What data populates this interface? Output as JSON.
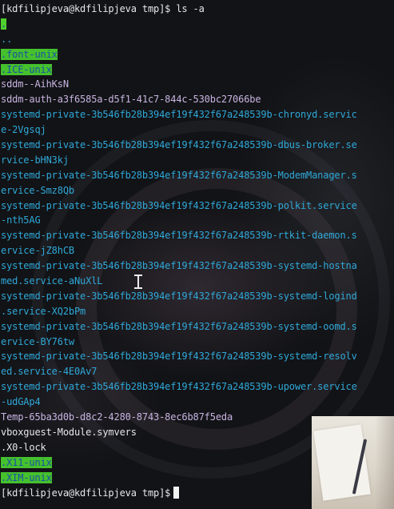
{
  "terminal": {
    "lines": [
      {
        "segments": [
          {
            "text": "[kdfilipjeva@kdfilipjeva tmp]$ ls -a",
            "style": "prompt"
          }
        ]
      },
      {
        "segments": [
          {
            "text": ".",
            "style": "hl-dot"
          }
        ]
      },
      {
        "segments": [
          {
            "text": "..",
            "style": "cyan"
          }
        ]
      },
      {
        "segments": [
          {
            "text": ".font-unix",
            "style": "hl"
          }
        ]
      },
      {
        "segments": [
          {
            "text": ".ICE-unix",
            "style": "hl"
          }
        ]
      },
      {
        "segments": [
          {
            "text": "sddm--AihKsN",
            "style": "violet"
          }
        ]
      },
      {
        "segments": [
          {
            "text": "sddm-auth-a3f6585a-d5f1-41c7-844c-530bc27066be",
            "style": "violet"
          }
        ]
      },
      {
        "segments": [
          {
            "text": "systemd-private-3b546fb28b394ef19f432f67a248539b-chronyd.servic",
            "style": "cyan"
          }
        ]
      },
      {
        "segments": [
          {
            "text": "e-2Vgsqj",
            "style": "cyan"
          }
        ]
      },
      {
        "segments": [
          {
            "text": "systemd-private-3b546fb28b394ef19f432f67a248539b-dbus-broker.se",
            "style": "cyan"
          }
        ]
      },
      {
        "segments": [
          {
            "text": "rvice-bHN3kj",
            "style": "cyan"
          }
        ]
      },
      {
        "segments": [
          {
            "text": "systemd-private-3b546fb28b394ef19f432f67a248539b-ModemManager.s",
            "style": "cyan"
          }
        ]
      },
      {
        "segments": [
          {
            "text": "ervice-Smz8Qb",
            "style": "cyan"
          }
        ]
      },
      {
        "segments": [
          {
            "text": "systemd-private-3b546fb28b394ef19f432f67a248539b-polkit.service",
            "style": "cyan"
          }
        ]
      },
      {
        "segments": [
          {
            "text": "-nth5AG",
            "style": "cyan"
          }
        ]
      },
      {
        "segments": [
          {
            "text": "systemd-private-3b546fb28b394ef19f432f67a248539b-rtkit-daemon.s",
            "style": "cyan"
          }
        ]
      },
      {
        "segments": [
          {
            "text": "ervice-jZ8hCB",
            "style": "cyan"
          }
        ]
      },
      {
        "segments": [
          {
            "text": "systemd-private-3b546fb28b394ef19f432f67a248539b-systemd-hostna",
            "style": "cyan"
          }
        ]
      },
      {
        "segments": [
          {
            "text": "med.service-aNuXlL",
            "style": "cyan"
          }
        ]
      },
      {
        "segments": [
          {
            "text": "systemd-private-3b546fb28b394ef19f432f67a248539b-systemd-logind",
            "style": "cyan"
          }
        ]
      },
      {
        "segments": [
          {
            "text": ".service-XQ2bPm",
            "style": "cyan"
          }
        ]
      },
      {
        "segments": [
          {
            "text": "systemd-private-3b546fb28b394ef19f432f67a248539b-systemd-oomd.s",
            "style": "cyan"
          }
        ]
      },
      {
        "segments": [
          {
            "text": "ervice-BY76tw",
            "style": "cyan"
          }
        ]
      },
      {
        "segments": [
          {
            "text": "systemd-private-3b546fb28b394ef19f432f67a248539b-systemd-resolv",
            "style": "cyan"
          }
        ]
      },
      {
        "segments": [
          {
            "text": "ed.service-4E0Av7",
            "style": "cyan"
          }
        ]
      },
      {
        "segments": [
          {
            "text": "systemd-private-3b546fb28b394ef19f432f67a248539b-upower.service",
            "style": "cyan"
          }
        ]
      },
      {
        "segments": [
          {
            "text": "-udGAp4",
            "style": "cyan"
          }
        ]
      },
      {
        "segments": [
          {
            "text": "Temp-65ba3d0b-d8c2-4280-8743-8ec6b87f5eda",
            "style": "violet"
          }
        ]
      },
      {
        "segments": [
          {
            "text": "vboxguest-Module.symvers",
            "style": "white"
          }
        ]
      },
      {
        "segments": [
          {
            "text": ".X0-lock",
            "style": "white"
          }
        ]
      },
      {
        "segments": [
          {
            "text": ".X11-unix",
            "style": "hl"
          }
        ]
      },
      {
        "segments": [
          {
            "text": ".XIM-unix",
            "style": "hl"
          }
        ]
      },
      {
        "segments": [
          {
            "text": "[kdfilipjeva@kdfilipjeva tmp]$",
            "style": "prompt"
          }
        ],
        "cursor": true
      }
    ]
  },
  "colors": {
    "background": "#121316",
    "prompt_text": "#e7e7ea",
    "directory_text": "#2fa8d8",
    "sticky_dir_highlight": "#45c12d",
    "sticky_dir_text": "#1b4fa3",
    "socket_text": "#c8b4e2"
  },
  "icons": {
    "mouse_cursor": "ibeam-cursor-icon",
    "terminal_cursor": "block-cursor-icon"
  }
}
